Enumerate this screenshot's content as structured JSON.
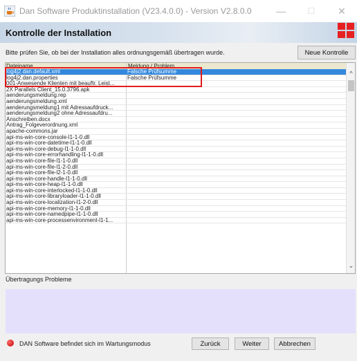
{
  "window": {
    "title": "Dan Software Produktinstallation (V23.4.0.0) - Version V2.8.0.0",
    "icon": "java-cup-icon",
    "minimize_glyph": "—",
    "maximize_glyph": "☐",
    "close_glyph": "✕"
  },
  "header": {
    "title": "Kontrolle der Installation",
    "logo_color": "#e62020"
  },
  "instruction": "Bitte prüfen Sie, ob bei der Installation alles ordnungsgemäß übertragen wurde.",
  "buttons": {
    "new_check": "Neue Kontrolle",
    "back": "Zurück",
    "next": "Weiter",
    "cancel": "Abbrechen"
  },
  "table": {
    "columns": [
      "Dateiname",
      "Meldung / Problem"
    ],
    "rows": [
      {
        "file": "log4j2.dan.default.xml",
        "message": "Falsche Prüfsumme",
        "selected": true
      },
      {
        "file": "log4j2.dan.properties",
        "message": "Falsche Prüfsumme"
      },
      {
        "file": "001-Anwesende Klienten mit beauftr. Leist...",
        "message": ""
      },
      {
        "file": "2X Parallels Client_15.0.3796.apk",
        "message": ""
      },
      {
        "file": "aenderungsmeldung.rep",
        "message": ""
      },
      {
        "file": "aenderungsmeldung.xml",
        "message": ""
      },
      {
        "file": "aenderungsmeldung1 mit Adressaufdruck...",
        "message": ""
      },
      {
        "file": "aenderungsmeldung2 ohne Adressaufdru...",
        "message": ""
      },
      {
        "file": "Anschreiben.docx",
        "message": ""
      },
      {
        "file": "Antrag_Folgeverordnung.xml",
        "message": ""
      },
      {
        "file": "apache-commons.jar",
        "message": ""
      },
      {
        "file": "api-ms-win-core-console-l1-1-0.dll",
        "message": ""
      },
      {
        "file": "api-ms-win-core-datetime-l1-1-0.dll",
        "message": ""
      },
      {
        "file": "api-ms-win-core-debug-l1-1-0.dll",
        "message": ""
      },
      {
        "file": "api-ms-win-core-errorhandling-l1-1-0.dll",
        "message": ""
      },
      {
        "file": "api-ms-win-core-file-l1-1-0.dll",
        "message": ""
      },
      {
        "file": "api-ms-win-core-file-l1-2-0.dll",
        "message": ""
      },
      {
        "file": "api-ms-win-core-file-l2-1-0.dll",
        "message": ""
      },
      {
        "file": "api-ms-win-core-handle-l1-1-0.dll",
        "message": ""
      },
      {
        "file": "api-ms-win-core-heap-l1-1-0.dll",
        "message": ""
      },
      {
        "file": "api-ms-win-core-interlocked-l1-1-0.dll",
        "message": ""
      },
      {
        "file": "api-ms-win-core-libraryloader-l1-1-0.dll",
        "message": ""
      },
      {
        "file": "api-ms-win-core-localization-l1-2-0.dll",
        "message": ""
      },
      {
        "file": "api-ms-win-core-memory-l1-1-0.dll",
        "message": ""
      },
      {
        "file": "api-ms-win-core-namedpipe-l1-1-0.dll",
        "message": ""
      },
      {
        "file": "api-ms-win-core-processenvironment-l1-1...",
        "message": ""
      }
    ],
    "scroll_up_glyph": "^",
    "scroll_down_glyph": "⌄",
    "highlight_color": "#e21b1b",
    "selection_color": "#3388dd"
  },
  "problems": {
    "label": "Übertragungs Probleme",
    "background": "#e4e0fb"
  },
  "status": {
    "text": "DAN Software befindet sich im Wartungsmodus",
    "indicator_color": "#d00000"
  }
}
